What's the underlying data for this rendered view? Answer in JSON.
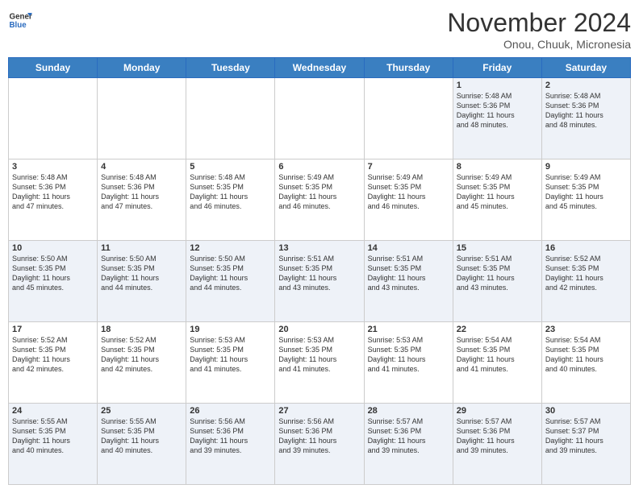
{
  "logo": {
    "line1": "General",
    "line2": "Blue"
  },
  "title": "November 2024",
  "location": "Onou, Chuuk, Micronesia",
  "days_of_week": [
    "Sunday",
    "Monday",
    "Tuesday",
    "Wednesday",
    "Thursday",
    "Friday",
    "Saturday"
  ],
  "weeks": [
    [
      {
        "day": "",
        "info": ""
      },
      {
        "day": "",
        "info": ""
      },
      {
        "day": "",
        "info": ""
      },
      {
        "day": "",
        "info": ""
      },
      {
        "day": "",
        "info": ""
      },
      {
        "day": "1",
        "info": "Sunrise: 5:48 AM\nSunset: 5:36 PM\nDaylight: 11 hours\nand 48 minutes."
      },
      {
        "day": "2",
        "info": "Sunrise: 5:48 AM\nSunset: 5:36 PM\nDaylight: 11 hours\nand 48 minutes."
      }
    ],
    [
      {
        "day": "3",
        "info": "Sunrise: 5:48 AM\nSunset: 5:36 PM\nDaylight: 11 hours\nand 47 minutes."
      },
      {
        "day": "4",
        "info": "Sunrise: 5:48 AM\nSunset: 5:36 PM\nDaylight: 11 hours\nand 47 minutes."
      },
      {
        "day": "5",
        "info": "Sunrise: 5:48 AM\nSunset: 5:35 PM\nDaylight: 11 hours\nand 46 minutes."
      },
      {
        "day": "6",
        "info": "Sunrise: 5:49 AM\nSunset: 5:35 PM\nDaylight: 11 hours\nand 46 minutes."
      },
      {
        "day": "7",
        "info": "Sunrise: 5:49 AM\nSunset: 5:35 PM\nDaylight: 11 hours\nand 46 minutes."
      },
      {
        "day": "8",
        "info": "Sunrise: 5:49 AM\nSunset: 5:35 PM\nDaylight: 11 hours\nand 45 minutes."
      },
      {
        "day": "9",
        "info": "Sunrise: 5:49 AM\nSunset: 5:35 PM\nDaylight: 11 hours\nand 45 minutes."
      }
    ],
    [
      {
        "day": "10",
        "info": "Sunrise: 5:50 AM\nSunset: 5:35 PM\nDaylight: 11 hours\nand 45 minutes."
      },
      {
        "day": "11",
        "info": "Sunrise: 5:50 AM\nSunset: 5:35 PM\nDaylight: 11 hours\nand 44 minutes."
      },
      {
        "day": "12",
        "info": "Sunrise: 5:50 AM\nSunset: 5:35 PM\nDaylight: 11 hours\nand 44 minutes."
      },
      {
        "day": "13",
        "info": "Sunrise: 5:51 AM\nSunset: 5:35 PM\nDaylight: 11 hours\nand 43 minutes."
      },
      {
        "day": "14",
        "info": "Sunrise: 5:51 AM\nSunset: 5:35 PM\nDaylight: 11 hours\nand 43 minutes."
      },
      {
        "day": "15",
        "info": "Sunrise: 5:51 AM\nSunset: 5:35 PM\nDaylight: 11 hours\nand 43 minutes."
      },
      {
        "day": "16",
        "info": "Sunrise: 5:52 AM\nSunset: 5:35 PM\nDaylight: 11 hours\nand 42 minutes."
      }
    ],
    [
      {
        "day": "17",
        "info": "Sunrise: 5:52 AM\nSunset: 5:35 PM\nDaylight: 11 hours\nand 42 minutes."
      },
      {
        "day": "18",
        "info": "Sunrise: 5:52 AM\nSunset: 5:35 PM\nDaylight: 11 hours\nand 42 minutes."
      },
      {
        "day": "19",
        "info": "Sunrise: 5:53 AM\nSunset: 5:35 PM\nDaylight: 11 hours\nand 41 minutes."
      },
      {
        "day": "20",
        "info": "Sunrise: 5:53 AM\nSunset: 5:35 PM\nDaylight: 11 hours\nand 41 minutes."
      },
      {
        "day": "21",
        "info": "Sunrise: 5:53 AM\nSunset: 5:35 PM\nDaylight: 11 hours\nand 41 minutes."
      },
      {
        "day": "22",
        "info": "Sunrise: 5:54 AM\nSunset: 5:35 PM\nDaylight: 11 hours\nand 41 minutes."
      },
      {
        "day": "23",
        "info": "Sunrise: 5:54 AM\nSunset: 5:35 PM\nDaylight: 11 hours\nand 40 minutes."
      }
    ],
    [
      {
        "day": "24",
        "info": "Sunrise: 5:55 AM\nSunset: 5:35 PM\nDaylight: 11 hours\nand 40 minutes."
      },
      {
        "day": "25",
        "info": "Sunrise: 5:55 AM\nSunset: 5:35 PM\nDaylight: 11 hours\nand 40 minutes."
      },
      {
        "day": "26",
        "info": "Sunrise: 5:56 AM\nSunset: 5:36 PM\nDaylight: 11 hours\nand 39 minutes."
      },
      {
        "day": "27",
        "info": "Sunrise: 5:56 AM\nSunset: 5:36 PM\nDaylight: 11 hours\nand 39 minutes."
      },
      {
        "day": "28",
        "info": "Sunrise: 5:57 AM\nSunset: 5:36 PM\nDaylight: 11 hours\nand 39 minutes."
      },
      {
        "day": "29",
        "info": "Sunrise: 5:57 AM\nSunset: 5:36 PM\nDaylight: 11 hours\nand 39 minutes."
      },
      {
        "day": "30",
        "info": "Sunrise: 5:57 AM\nSunset: 5:37 PM\nDaylight: 11 hours\nand 39 minutes."
      }
    ]
  ]
}
